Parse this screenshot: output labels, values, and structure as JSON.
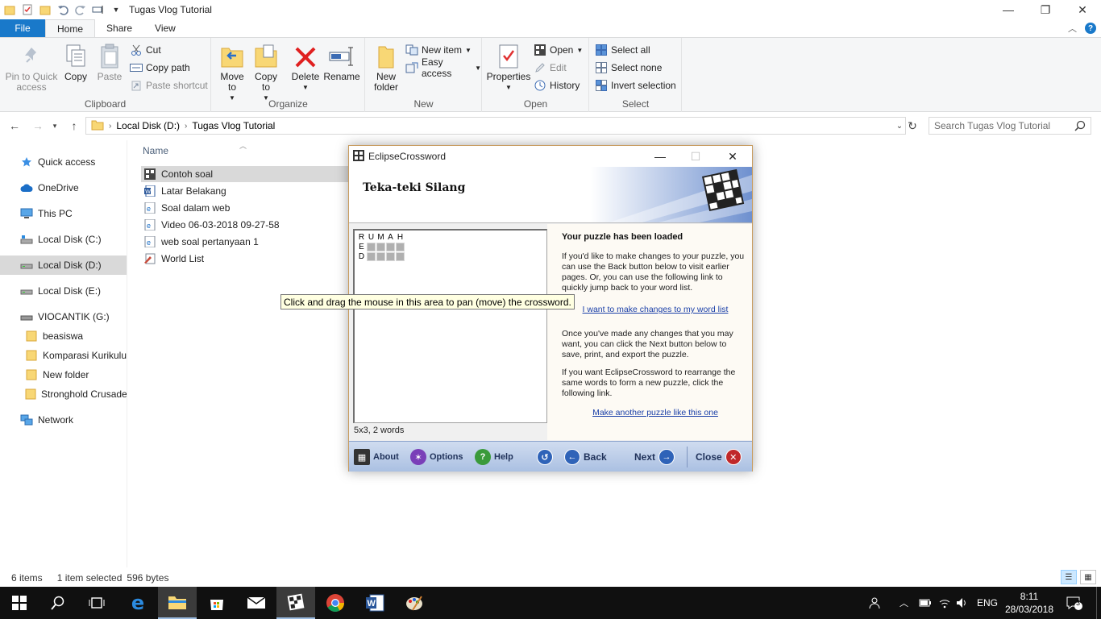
{
  "window": {
    "title": "Tugas Vlog Tutorial"
  },
  "ribbon_tabs": {
    "file": "File",
    "home": "Home",
    "share": "Share",
    "view": "View"
  },
  "ribbon": {
    "clipboard": {
      "label": "Clipboard",
      "pin": "Pin to Quick access",
      "copy": "Copy",
      "paste": "Paste",
      "cut": "Cut",
      "copy_path": "Copy path",
      "paste_shortcut": "Paste shortcut"
    },
    "organize": {
      "label": "Organize",
      "move_to": "Move to",
      "copy_to": "Copy to",
      "delete": "Delete",
      "rename": "Rename"
    },
    "new": {
      "label": "New",
      "new_folder": "New folder",
      "new_item": "New item",
      "easy_access": "Easy access"
    },
    "open": {
      "label": "Open",
      "properties": "Properties",
      "open": "Open",
      "edit": "Edit",
      "history": "History"
    },
    "select": {
      "label": "Select",
      "select_all": "Select all",
      "select_none": "Select none",
      "invert_selection": "Invert selection"
    }
  },
  "address": {
    "segment1": "Local Disk (D:)",
    "segment2": "Tugas Vlog Tutorial",
    "search_placeholder": "Search Tugas Vlog Tutorial"
  },
  "nav": {
    "quick_access": "Quick access",
    "onedrive": "OneDrive",
    "this_pc": "This PC",
    "local_c": "Local Disk (C:)",
    "local_d": "Local Disk (D:)",
    "local_e": "Local Disk (E:)",
    "viocantik": "VIOCANTIK (G:)",
    "beasiswa": "beasiswa",
    "komparasi": "Komparasi Kurikulu",
    "new_folder": "New folder",
    "stronghold": "Stronghold Crusade",
    "network": "Network"
  },
  "files": {
    "column_name": "Name",
    "items": [
      {
        "name": "Contoh soal",
        "icon": "crossword-icon"
      },
      {
        "name": "Latar Belakang",
        "icon": "word-doc-icon"
      },
      {
        "name": "Soal dalam web",
        "icon": "html-doc-icon"
      },
      {
        "name": "Video 06-03-2018 09-27-58",
        "icon": "html-doc-icon"
      },
      {
        "name": "web soal pertanyaan 1",
        "icon": "html-doc-icon"
      },
      {
        "name": "World List",
        "icon": "wordlist-icon"
      }
    ]
  },
  "status": {
    "count": "6 items",
    "selected": "1 item selected",
    "size": "596 bytes"
  },
  "dialog": {
    "title": "EclipseCrossword",
    "heading": "Teka-teki Silang",
    "crossword_rows": [
      [
        "R",
        "U",
        "M",
        "A",
        "H"
      ],
      [
        "E",
        "",
        "",
        "",
        ""
      ],
      [
        "D",
        "",
        "",
        "",
        ""
      ]
    ],
    "size_label": "5x3, 2 words",
    "info_title": "Your puzzle has been loaded",
    "para1": "If you'd like to make changes to your puzzle, you can use the Back button below to visit earlier pages.  Or, you can use the following link to quickly jump back to your word list.",
    "link1": "I want to make changes to my word list",
    "para2": "Once you've made any changes that you may want, you can click the Next button below to save, print, and export the puzzle.",
    "para3": "If you want EclipseCrossword to rearrange the same words to form a new puzzle, click the following link.",
    "link2": "Make another puzzle like this one",
    "buttons": {
      "about": "About",
      "options": "Options",
      "help": "Help",
      "back": "Back",
      "next": "Next",
      "close": "Close"
    }
  },
  "tooltip": "Click and drag the mouse in this area to pan (move) the crossword.",
  "taskbar": {
    "lang": "ENG",
    "time": "8:11",
    "date": "28/03/2018",
    "notifications": "3"
  },
  "colors": {
    "accent": "#1979ca",
    "selection": "#d9d9d9",
    "taskbar": "#101010"
  }
}
